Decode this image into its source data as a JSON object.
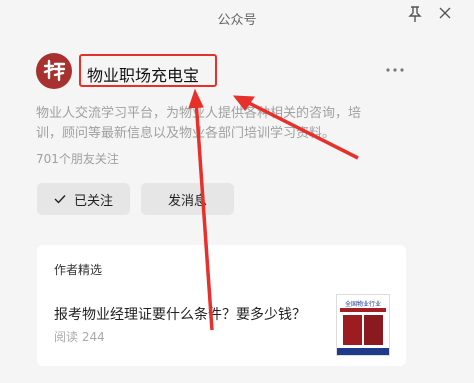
{
  "window": {
    "title": "公众号"
  },
  "account": {
    "avatar_glyph": "特",
    "name": "物业职场充电宝",
    "description": "物业人交流学习平台，为物业人提供各种相关的咨询，培训，顾问等最新信息以及物业各部门培训学习资料。",
    "followers": "701个朋友关注"
  },
  "actions": {
    "follow_label": "已关注",
    "message_label": "发消息"
  },
  "featured": {
    "heading": "作者精选",
    "article": {
      "title": "报考物业经理证要什么条件？要多少钱？",
      "reads": "阅读 244",
      "thumb_title": "全国物业行业"
    }
  },
  "colors": {
    "annotation": "#e8302b",
    "avatar_bg": "#a8312f"
  },
  "icons": [
    "pin-icon",
    "close-icon",
    "more-icon",
    "check-icon"
  ]
}
